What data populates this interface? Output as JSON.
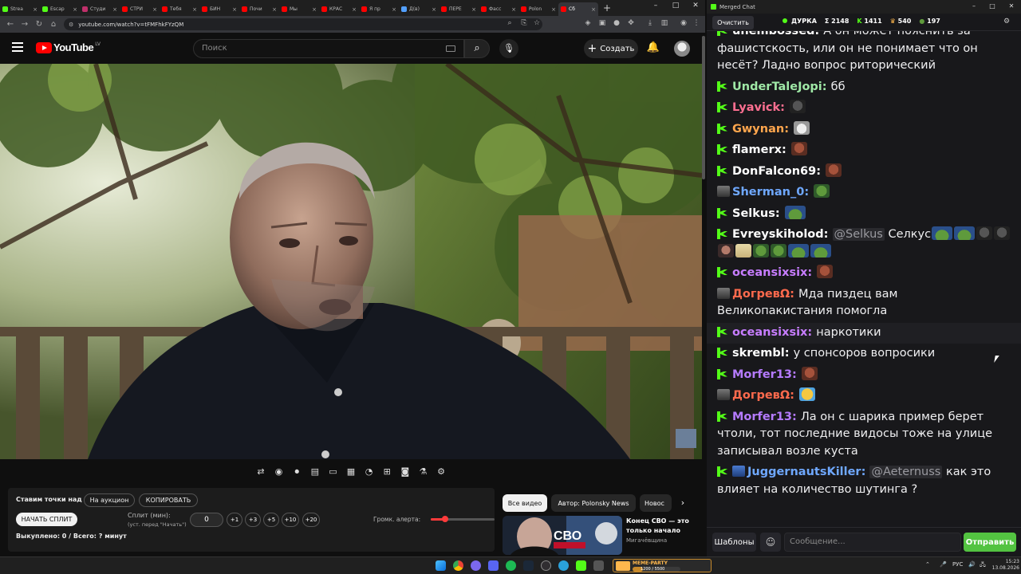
{
  "browser": {
    "tabs": [
      {
        "title": "Strea",
        "color": "#53fc18"
      },
      {
        "title": "Escap",
        "color": "#53fc18"
      },
      {
        "title": "Студи",
        "color": "#c0306a"
      },
      {
        "title": "СТРИ",
        "color": "#ff0000"
      },
      {
        "title": "Тебя",
        "color": "#ff0000"
      },
      {
        "title": "БИН",
        "color": "#ff0000"
      },
      {
        "title": "Почи",
        "color": "#ff0000"
      },
      {
        "title": "Мы",
        "color": "#ff0000"
      },
      {
        "title": "КРАС",
        "color": "#ff0000"
      },
      {
        "title": "Я пр",
        "color": "#ff0000"
      },
      {
        "title": "Д(в)",
        "color": "#53a0ff"
      },
      {
        "title": "ПЕРЕ",
        "color": "#ff0000"
      },
      {
        "title": "Фасс",
        "color": "#ff0000"
      },
      {
        "title": "Polon",
        "color": "#ff0000"
      },
      {
        "title": "Сб",
        "color": "#ff0000"
      }
    ],
    "url": "youtube.com/watch?v=tFMFhkFYzQM",
    "window_controls": [
      "–",
      "□",
      "✕"
    ]
  },
  "youtube": {
    "logo_text": "YouTube",
    "country": "LV",
    "search_placeholder": "Поиск",
    "create_label": "Создать",
    "toolbar_icons": [
      "repeat-icon",
      "broadcast-icon",
      "record-icon",
      "clapper-icon",
      "frame-icon",
      "subtitles-icon",
      "speedometer-icon",
      "add-frame-icon",
      "camera-icon",
      "flask-icon",
      "gear-icon"
    ]
  },
  "panel": {
    "title": "Ставим точки над i",
    "auction_label": "На аукцион",
    "copy_label": "КОПИРОВАТЬ",
    "start_label": "НАЧАТЬ СПЛИТ",
    "split_label": "Сплит (мин):",
    "split_hint": "(уст. перед \"Начать\")",
    "split_value": "0",
    "increments": [
      "+1",
      "+3",
      "+5",
      "+10",
      "+20"
    ],
    "bought_label": "Выкуплено: 0 / Всего: ? минут",
    "volume_label": "Громк. алерта:",
    "volume_fraction": 0.23
  },
  "recommendations": {
    "chips": [
      "Все видео",
      "Автор: Polonsky News",
      "Новос"
    ],
    "video_title": "Конец СВО — это только начало",
    "video_channel": "Мигачёвщина",
    "thumb_text": "СВО"
  },
  "chat": {
    "window_title": "Merged Chat",
    "clear_label": "Очистить",
    "channel": "ДУРКА",
    "stats": {
      "total": "Σ 2148",
      "kick": "1411",
      "other": "540",
      "pepe": "197"
    },
    "messages": [
      {
        "badge": "kick",
        "user": "unembossed",
        "color": "#ffffff",
        "text": "А он может пояснить за фашистскость, или он не понимает что он несёт? Ладно вопрос риторический"
      },
      {
        "badge": "kick",
        "user": "UnderTaleJopi",
        "color": "#9fe8a6",
        "text": "бб"
      },
      {
        "badge": "kick",
        "user": "Lyavick",
        "color": "#ff6f91",
        "emotes": [
          "e-dark"
        ]
      },
      {
        "badge": "kick",
        "user": "Gwynan",
        "color": "#ffa64d",
        "emotes": [
          "e-cat"
        ]
      },
      {
        "badge": "kick",
        "user": "flamerx",
        "color": "#ffffff",
        "emotes": [
          "e-face"
        ]
      },
      {
        "badge": "kick",
        "user": "DonFalcon69",
        "color": "#ffffff",
        "emotes": [
          "e-face"
        ]
      },
      {
        "badge": "avatar",
        "user": "Sherman_0",
        "color": "#6fa8ff",
        "emotes": [
          "e-pepe"
        ]
      },
      {
        "badge": "kick",
        "user": "Selkus",
        "color": "#ffffff",
        "emotes": [
          "e-pepes"
        ]
      },
      {
        "badge": "kick",
        "user": "Evreyskiholod",
        "color": "#ffffff",
        "mention": "@Selkus",
        "text": "Селкус",
        "emotes": [
          "e-pepes",
          "e-pepes",
          "e-dark",
          "e-dark",
          "e-girl",
          "e-blond",
          "e-pepe",
          "e-pepe",
          "e-pepes",
          "e-pepes"
        ]
      },
      {
        "badge": "kick",
        "user": "oceansixsix",
        "color": "#c77dff",
        "emotes": [
          "e-face"
        ]
      },
      {
        "badge": "avatar",
        "user": "ДогревΩ",
        "color": "#ff6a4d",
        "text": "Мда пиздец вам Великопакистания помогла"
      },
      {
        "badge": "kick",
        "user": "oceansixsix",
        "color": "#c77dff",
        "text": "наркотики",
        "highlight": true
      },
      {
        "badge": "kick",
        "user": "skrembl",
        "color": "#ffffff",
        "text": "у спонсоров вопросики"
      },
      {
        "badge": "kick",
        "user": "Morfer13",
        "color": "#b57bff",
        "emotes": [
          "e-face"
        ]
      },
      {
        "badge": "avatar",
        "user": "ДогревΩ",
        "color": "#ff6a4d",
        "emotes": [
          "e-laugh"
        ]
      },
      {
        "badge": "kick",
        "user": "Morfer13",
        "color": "#b57bff",
        "text": "Ла он с шарика пример берет чтоли, тот последние видосы тоже на улице записывал возле куста"
      },
      {
        "badge": "kick+avatar",
        "user": "JuggernautsKiller",
        "color": "#6fa8ff",
        "mention": "@Aeternuss",
        "text": "как это влияет на количество шутинга ?"
      }
    ],
    "templates_label": "Шаблоны",
    "input_placeholder": "Сообщение...",
    "send_label": "Отправить"
  },
  "taskbar": {
    "widget_name": "MEME-PARTY",
    "widget_value": "1200 / 5500",
    "widget_fraction": 0.22,
    "lang": "РУС",
    "time": "15:23",
    "date": "13.08.2026"
  }
}
